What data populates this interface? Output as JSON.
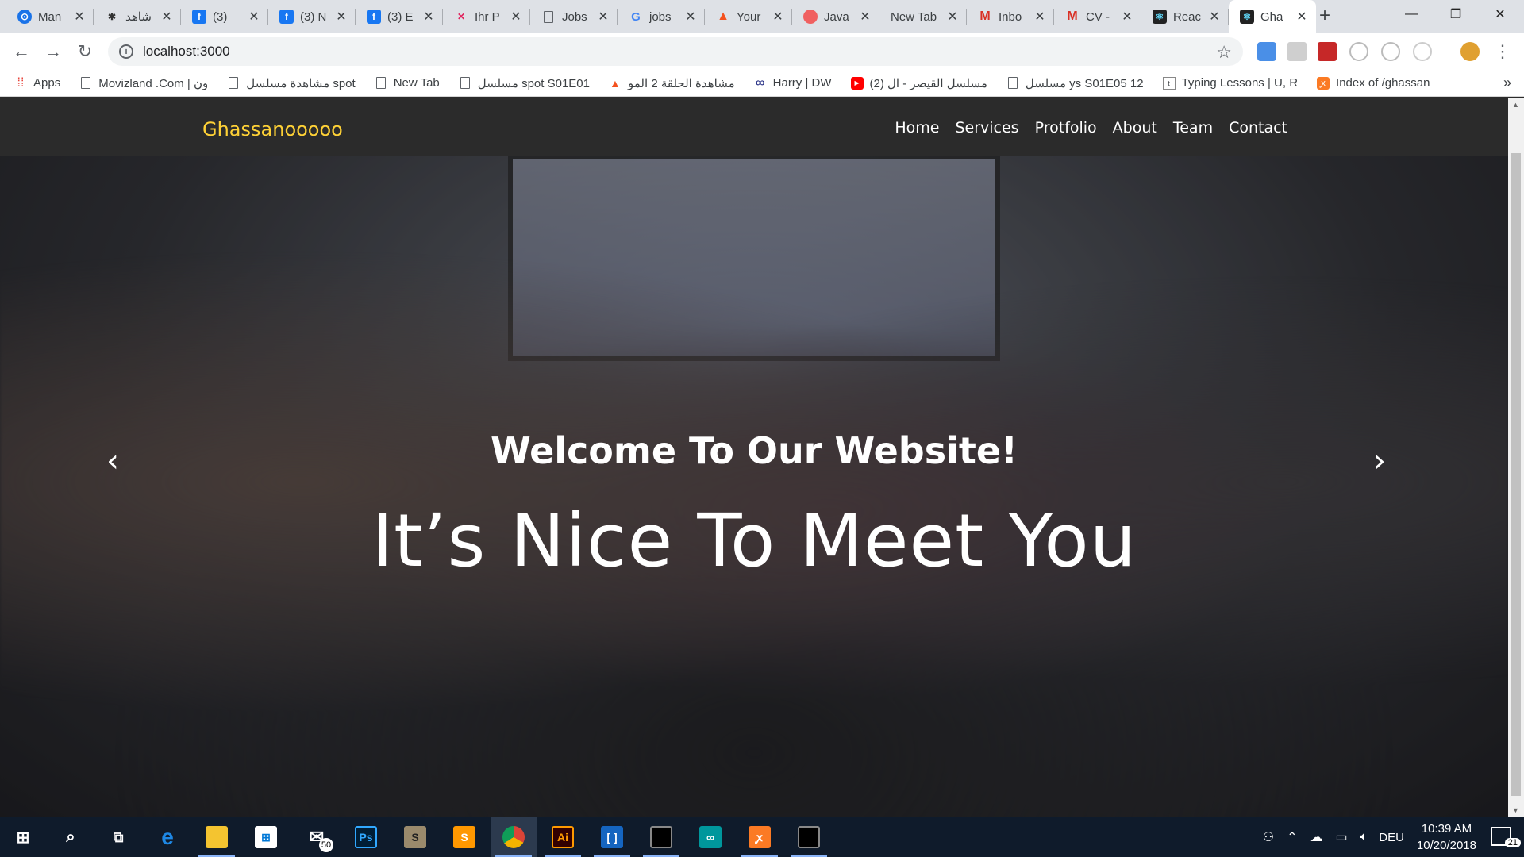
{
  "browser": {
    "tabs": [
      {
        "title": "Man",
        "icon": "chrome-status-icon",
        "color": "#1a73e8"
      },
      {
        "title": "شاهد",
        "icon": "spider-icon",
        "color": "#333333"
      },
      {
        "title": "(3)",
        "icon": "facebook-icon",
        "color": "#1877f2"
      },
      {
        "title": "(3) N",
        "icon": "facebook-icon",
        "color": "#1877f2"
      },
      {
        "title": "(3) E",
        "icon": "facebook-icon",
        "color": "#1877f2"
      },
      {
        "title": "Ihr P",
        "icon": "xing-icon",
        "color": "#e0245e"
      },
      {
        "title": "Jobs",
        "icon": "document-icon",
        "color": "#5f6368"
      },
      {
        "title": "jobs",
        "icon": "google-icon",
        "color": "#ea4335"
      },
      {
        "title": "Your",
        "icon": "warning-icon",
        "color": "#f4511e"
      },
      {
        "title": "Java",
        "icon": "circle-app-icon",
        "color": "#f06060"
      },
      {
        "title": "New Tab",
        "icon": "none",
        "color": "#ffffff"
      },
      {
        "title": "Inbo",
        "icon": "gmail-icon",
        "color": "#d93025"
      },
      {
        "title": "CV -",
        "icon": "gmail-icon",
        "color": "#d93025"
      },
      {
        "title": "Reac",
        "icon": "react-icon",
        "color": "#222222"
      },
      {
        "title": "Gha",
        "icon": "react-icon",
        "color": "#222222",
        "active": true
      }
    ],
    "new_tab_label": "+",
    "url": "localhost:3000",
    "bookmarks": [
      {
        "label": "Apps",
        "icon": "apps-grid-icon"
      },
      {
        "label": "Movizland .Com | ون",
        "icon": "document-icon"
      },
      {
        "label": "مشاهدة مسلسل spot",
        "icon": "document-icon"
      },
      {
        "label": "New Tab",
        "icon": "document-icon"
      },
      {
        "label": "مسلسل spot S01E01",
        "icon": "document-icon"
      },
      {
        "label": "مشاهدة الحلقة 2 المو",
        "icon": "warning-icon"
      },
      {
        "label": "Harry | DW",
        "icon": "infinity-icon"
      },
      {
        "label": "(2) مسلسل القيصر - ال",
        "icon": "youtube-icon"
      },
      {
        "label": "مسلسل ys S01E05 12",
        "icon": "document-icon"
      },
      {
        "label": "Typing Lessons | U, R",
        "icon": "typing-icon"
      },
      {
        "label": "Index of /ghassan",
        "icon": "xampp-icon"
      }
    ],
    "bookmarks_more": "»"
  },
  "site": {
    "brand": "Ghassanooooo",
    "nav": [
      "Home",
      "Services",
      "Protfolio",
      "About",
      "Team",
      "Contact"
    ],
    "hero_subtitle": "Welcome To Our Website!",
    "hero_title": "It’s Nice To Meet You",
    "prev_arrow": "‹",
    "next_arrow": "›",
    "brand_color": "#fed136"
  },
  "taskbar": {
    "apps": [
      {
        "name": "start",
        "icon": "windows-icon"
      },
      {
        "name": "search",
        "icon": "search-icon"
      },
      {
        "name": "task-view",
        "icon": "task-view-icon"
      },
      {
        "name": "edge",
        "icon": "edge-icon",
        "label": "e"
      },
      {
        "name": "explorer",
        "icon": "folder-icon"
      },
      {
        "name": "store",
        "icon": "store-icon"
      },
      {
        "name": "mail",
        "icon": "mail-icon",
        "badge": "50"
      },
      {
        "name": "photoshop",
        "icon": "photoshop-icon",
        "label": "Ps"
      },
      {
        "name": "app-s",
        "icon": "s-app-icon",
        "label": "S"
      },
      {
        "name": "sublime",
        "icon": "sublime-icon",
        "label": "S"
      },
      {
        "name": "chrome",
        "icon": "chrome-icon"
      },
      {
        "name": "illustrator",
        "icon": "illustrator-icon",
        "label": "Ai"
      },
      {
        "name": "app-bracket",
        "icon": "bracket-icon",
        "label": "[ ]"
      },
      {
        "name": "terminal",
        "icon": "terminal-icon"
      },
      {
        "name": "arduino",
        "icon": "arduino-icon",
        "label": "∞"
      },
      {
        "name": "xampp",
        "icon": "xampp-icon",
        "label": "ꭙ"
      },
      {
        "name": "cmd",
        "icon": "cmd-icon"
      }
    ],
    "language": "DEU",
    "time": "10:39 AM",
    "date": "10/20/2018",
    "notifications": "21"
  }
}
